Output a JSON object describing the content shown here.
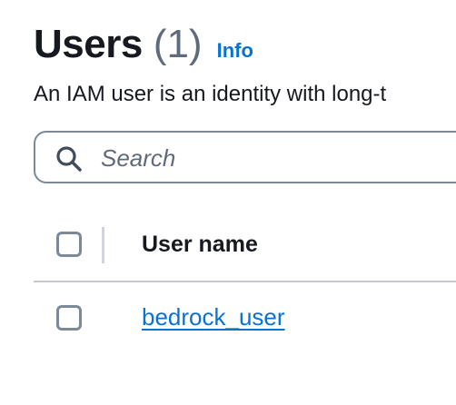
{
  "header": {
    "title": "Users",
    "count": "(1)",
    "info_label": "Info"
  },
  "description": "An IAM user is an identity with long-t",
  "search": {
    "placeholder": "Search",
    "value": "",
    "icon": "search-icon"
  },
  "table": {
    "columns": [
      "User name"
    ],
    "rows": [
      {
        "user_name": "bedrock_user",
        "selected": false
      }
    ],
    "select_all": false
  },
  "colors": {
    "link": "#0972d3",
    "text": "#16191f",
    "muted": "#5f6b7a",
    "border": "#7d8998"
  }
}
